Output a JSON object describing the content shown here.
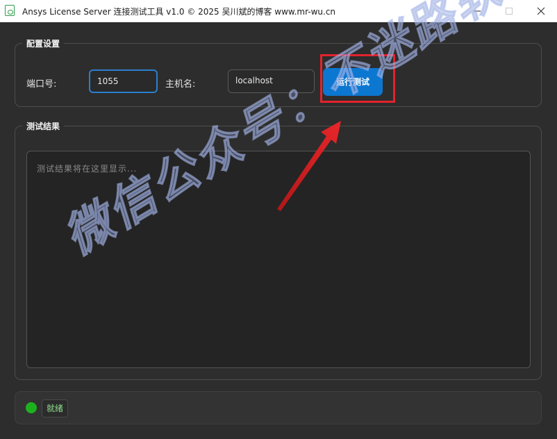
{
  "window": {
    "title": "Ansys License Server 连接测试工具 v1.0 © 2025 吴川斌的博客 www.mr-wu.cn"
  },
  "config": {
    "group_title": "配置设置",
    "port_label": "端口号:",
    "port_value": "1055",
    "host_label": "主机名:",
    "host_value": "localhost",
    "run_button_label": "运行测试"
  },
  "results": {
    "group_title": "测试结果",
    "placeholder": "测试结果将在这里显示..."
  },
  "status": {
    "text": "就绪",
    "color": "#1db21d"
  },
  "watermark": {
    "text": "微信公众号：不迷路软件库"
  },
  "colors": {
    "accent": "#0c77d0",
    "highlight": "#e3232d",
    "background": "#2d2d2d"
  }
}
